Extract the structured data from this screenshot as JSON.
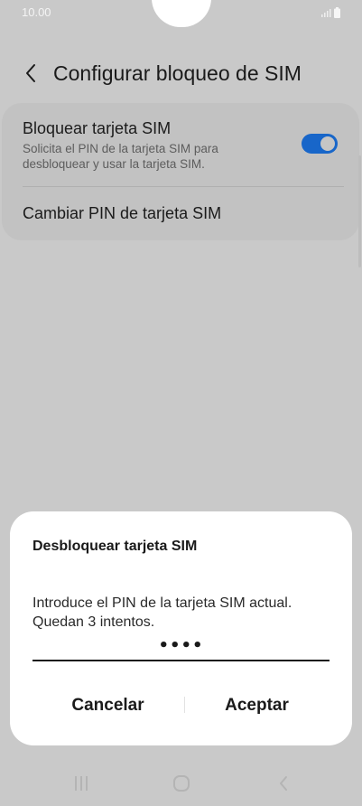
{
  "status_bar": {
    "time": "10.00",
    "icons": [
      "signal-icon",
      "battery-icon"
    ]
  },
  "header": {
    "back_icon": "chevron-left-icon",
    "title": "Configurar bloqueo de SIM"
  },
  "settings": {
    "sim_lock": {
      "title": "Bloquear tarjeta SIM",
      "subtitle": "Solicita el PIN de la tarjeta SIM para desbloquear y usar la tarjeta SIM.",
      "enabled": true
    },
    "change_pin": {
      "title": "Cambiar PIN de tarjeta SIM"
    }
  },
  "dialog": {
    "title": "Desbloquear tarjeta SIM",
    "message": "Introduce el PIN de la tarjeta SIM actual. Quedan 3 intentos.",
    "pin_value": "••••",
    "cancel_label": "Cancelar",
    "accept_label": "Aceptar"
  },
  "nav_bar": {
    "icons": [
      "recents-icon",
      "home-icon",
      "back-icon"
    ]
  },
  "colors": {
    "accent": "#1866c9",
    "dim_background": "#c9c9c9",
    "dialog_background": "#ffffff"
  }
}
